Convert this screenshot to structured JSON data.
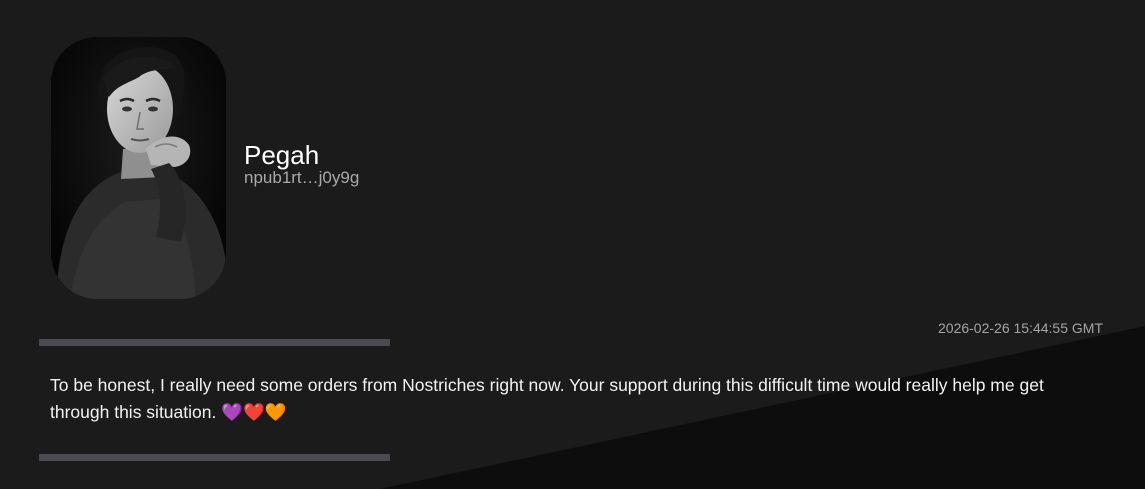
{
  "author": {
    "name": "Pegah",
    "npub": "npub1rt…j0y9g",
    "avatar_icon": "portrait-photo"
  },
  "note": {
    "timestamp": "2026-02-26 15:44:55 GMT",
    "content": "To be honest, I really need some orders from Nostriches right now. Your support during this difficult time would really help me get through this situation. 💜❤️🧡"
  },
  "colors": {
    "background": "#1b1b1b",
    "background_shadow": "#0d0d0d",
    "divider": "#4b4a50",
    "muted_text": "#a8a8a8"
  }
}
